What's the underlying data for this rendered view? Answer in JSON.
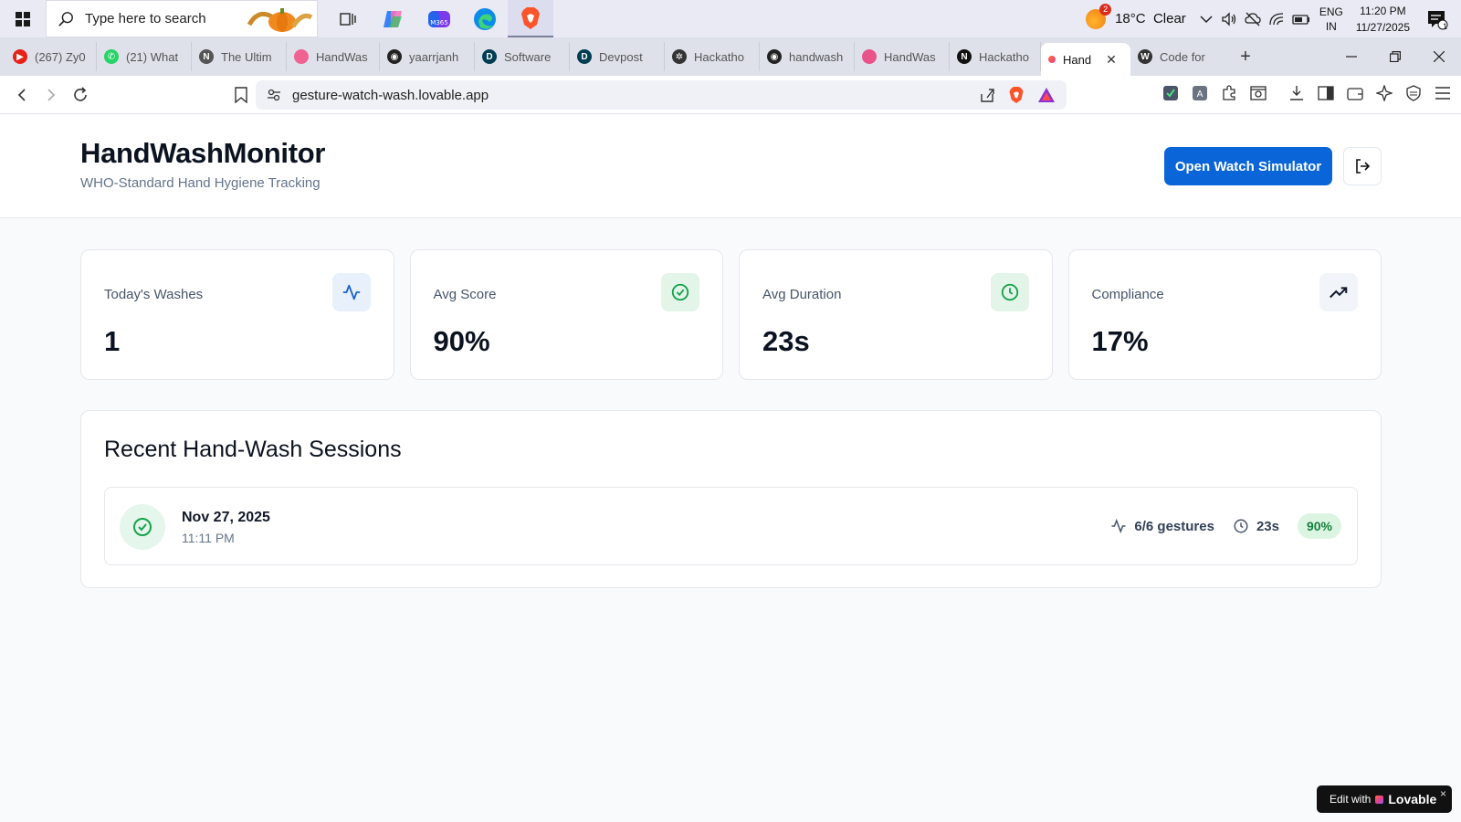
{
  "taskbar": {
    "search_placeholder": "Type here to search",
    "weather": {
      "temp": "18°C",
      "condition": "Clear",
      "badge": "2"
    },
    "lang": {
      "line1": "ENG",
      "line2": "IN"
    },
    "clock": {
      "time": "11:20 PM",
      "date": "11/27/2025"
    },
    "notifications_count": "1"
  },
  "browser": {
    "tabs": [
      {
        "title": "(267) Zy0",
        "color": "#e62117",
        "glyph": "▶"
      },
      {
        "title": "(21) What",
        "color": "#25d366",
        "glyph": "✆"
      },
      {
        "title": "The Ultim",
        "color": "#555555",
        "glyph": "N"
      },
      {
        "title": "HandWas",
        "color": "#f06292",
        "glyph": ""
      },
      {
        "title": "yaarrjanh",
        "color": "#222222",
        "glyph": "◉"
      },
      {
        "title": "Software",
        "color": "#003e54",
        "glyph": "D"
      },
      {
        "title": "Devpost",
        "color": "#003e54",
        "glyph": "D"
      },
      {
        "title": "Hackatho",
        "color": "#333333",
        "glyph": "✲"
      },
      {
        "title": "handwash",
        "color": "#222222",
        "glyph": "◉"
      },
      {
        "title": "HandWas",
        "color": "#e8538a",
        "glyph": ""
      },
      {
        "title": "Hackatho",
        "color": "#111111",
        "glyph": "N"
      }
    ],
    "active_tab": {
      "title": "Hand",
      "close": "✕"
    },
    "after_tab": {
      "title": "Code for",
      "color": "#333333",
      "glyph": "W"
    },
    "new_tab": "+",
    "url": "gesture-watch-wash.lovable.app"
  },
  "app": {
    "title": "HandWashMonitor",
    "subtitle": "WHO-Standard Hand Hygiene Tracking",
    "open_simulator": "Open Watch Simulator"
  },
  "stats": [
    {
      "label": "Today's Washes",
      "value": "1",
      "icon": "activity-icon",
      "bg": "#e8f0fb",
      "fg": "#1d63c9"
    },
    {
      "label": "Avg Score",
      "value": "90%",
      "icon": "check-circle-icon",
      "bg": "#e3f5e9",
      "fg": "#16a34a"
    },
    {
      "label": "Avg Duration",
      "value": "23s",
      "icon": "clock-icon",
      "bg": "#e3f5e9",
      "fg": "#16a34a"
    },
    {
      "label": "Compliance",
      "value": "17%",
      "icon": "trending-up-icon",
      "bg": "#f1f5f9",
      "fg": "#0f172a"
    }
  ],
  "sessions": {
    "title": "Recent Hand-Wash Sessions",
    "rows": [
      {
        "date": "Nov 27, 2025",
        "time": "11:11 PM",
        "gestures": "6/6 gestures",
        "duration": "23s",
        "score": "90%"
      }
    ]
  },
  "lovable": {
    "prefix": "Edit with",
    "brand": "Lovable",
    "close": "×"
  }
}
